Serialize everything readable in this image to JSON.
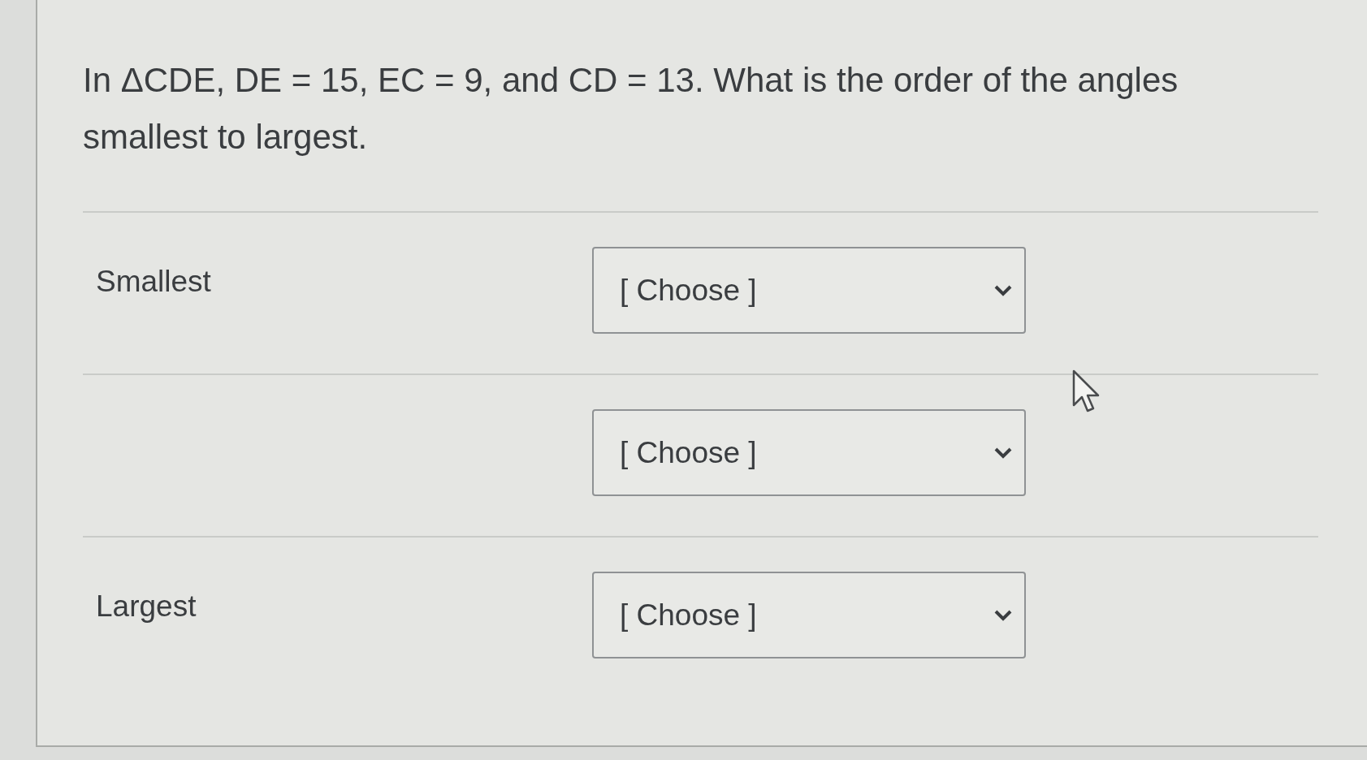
{
  "question": "In ΔCDE, DE = 15, EC = 9, and CD = 13. What is the order of the angles smallest to largest.",
  "rows": [
    {
      "label": "Smallest",
      "dropdown": {
        "value": "[ Choose ]"
      }
    },
    {
      "dropdown": {
        "value": "[ Choose ]"
      }
    },
    {
      "label": "Largest",
      "dropdown": {
        "value": "[ Choose ]"
      }
    }
  ]
}
